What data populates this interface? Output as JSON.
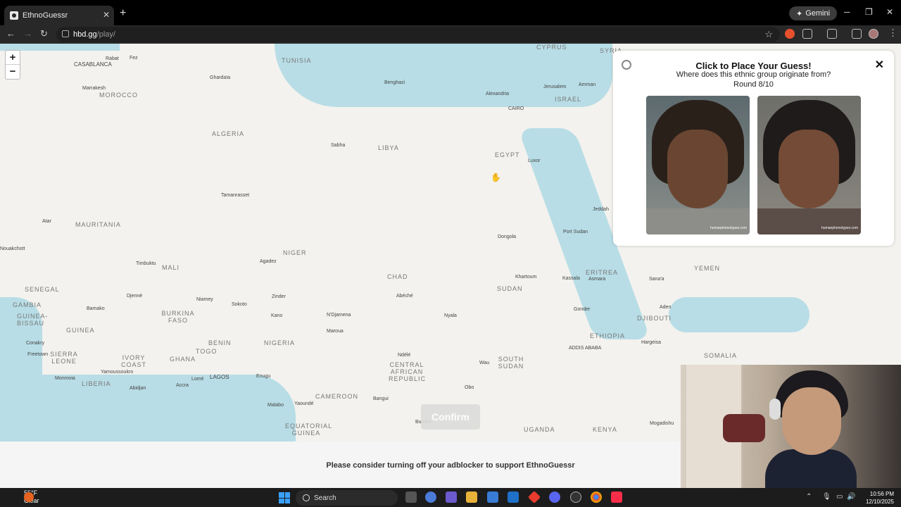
{
  "browser": {
    "tab_title": "EthnoGuessr",
    "gemini_label": "Gemini",
    "url_host": "hbd.gg",
    "url_path": "/play/"
  },
  "panel": {
    "title": "Click to Place Your Guess!",
    "question": "Where does this ethnic group originate from?",
    "round": "Round 8/10",
    "image_watermark": "humanphenotypes.com"
  },
  "confirm_label": "Confirm",
  "banner_text": "Please consider turning off your adblocker to support EthnoGuessr",
  "map": {
    "countries": [
      "TUNISIA",
      "MOROCCO",
      "ALGERIA",
      "LIBYA",
      "EGYPT",
      "ISRAEL",
      "MAURITANIA",
      "MALI",
      "NIGER",
      "CHAD",
      "SUDAN",
      "ERITREA",
      "YEMEN",
      "SENEGAL",
      "GAMBIA",
      "GUINEA-BISSAU",
      "GUINEA",
      "SIERRA LEONE",
      "LIBERIA",
      "IVORY COAST",
      "BURKINA FASO",
      "GHANA",
      "TOGO",
      "BENIN",
      "NIGERIA",
      "CAMEROON",
      "CENTRAL AFRICAN REPUBLIC",
      "SOUTH SUDAN",
      "ETHIOPIA",
      "DJIBOUTI",
      "SOMALIA",
      "UGANDA",
      "KENYA",
      "EQUATORIAL GUINEA",
      "SYRIA",
      "CYPRUS"
    ],
    "cities": [
      "CASABLANCA",
      "Rabat",
      "Fez",
      "Marrakesh",
      "Ghardaïa",
      "Benghazi",
      "Alexandria",
      "CAIRO",
      "Jerusalem",
      "Amman",
      "Sabha",
      "Luxor",
      "Tamanrasset",
      "Atar",
      "Jeddah",
      "Dongola",
      "Port Sudan",
      "Timbuktu",
      "Agadez",
      "Khartoum",
      "Kassala",
      "Asmara",
      "Sana'a",
      "Djenné",
      "Niamey",
      "Zinder",
      "Abéché",
      "Bamako",
      "Sokoto",
      "Kano",
      "N'Djamena",
      "Nyala",
      "Gonder",
      "Aden",
      "Maroua",
      "ADDIS ABABA",
      "Hargeisa",
      "Conakry",
      "Freetown",
      "Ndélé",
      "Wau",
      "Yamoussoukro",
      "Monrovia",
      "Abidjan",
      "Accra",
      "Lomé",
      "LAGOS",
      "Enugu",
      "Obo",
      "Bangui",
      "Malabo",
      "Yaoundé",
      "Bumba",
      "Mogadishu",
      "Nouakchott"
    ]
  },
  "taskbar": {
    "weather_temp": "55°F",
    "weather_desc": "Clear",
    "search_label": "Search",
    "time": "10:56 PM",
    "date": "12/10/2025"
  },
  "colors": {
    "land": "#f3f2ee",
    "water": "#b8dde6",
    "panel_bg": "#ffffff",
    "taskbar": "#1c1c1c"
  }
}
